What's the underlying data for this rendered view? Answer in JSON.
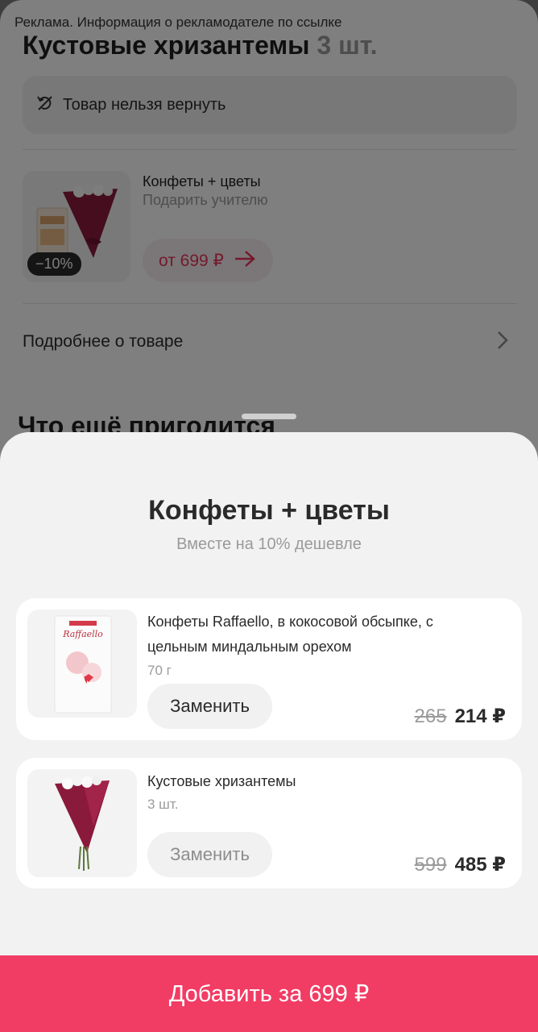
{
  "background": {
    "ad_notice": "Реклама. Информация о рекламодателе по ссылке",
    "title": "Кустовые хризантемы",
    "title_qty": "3 шт.",
    "return_notice": "Товар нельзя вернуть",
    "combo": {
      "title": "Конфеты + цветы",
      "subtitle": "Подарить учителю",
      "discount": "−10%",
      "price": "от 699 ₽"
    },
    "more_link": "Подробнее о товаре",
    "section_title": "Что ещё пригодится"
  },
  "sheet": {
    "title": "Конфеты + цветы",
    "subtitle": "Вместе на 10% дешевле",
    "items": [
      {
        "name": "Конфеты Raffaello, в кокосовой обсыпке, с цельным миндальным орехом",
        "weight": "70 г",
        "replace_label": "Заменить",
        "old_price": "265",
        "price": "214 ₽",
        "brand": "Raffaello"
      },
      {
        "name": "Кустовые хризантемы",
        "weight": "3 шт.",
        "replace_label": "Заменить",
        "old_price": "599",
        "price": "485 ₽"
      }
    ],
    "add_button": "Добавить за 699 ₽"
  },
  "colors": {
    "accent": "#f13c64",
    "price_accent": "#e8335a",
    "wrap": "#8a1a3c"
  },
  "icons": [
    "no-return-icon",
    "arrow-right-icon",
    "chevron-right-icon"
  ]
}
